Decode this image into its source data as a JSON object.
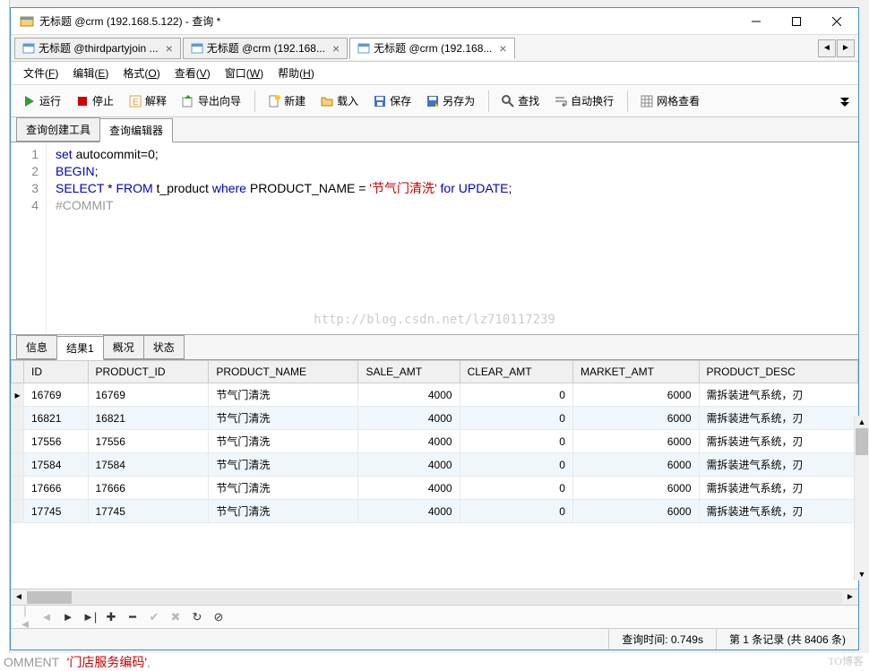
{
  "title": "无标题 @crm (192.168.5.122) - 查询 *",
  "docTabs": [
    {
      "label": "无标题 @thirdpartyjoin ...",
      "active": false
    },
    {
      "label": "无标题 @crm (192.168...",
      "active": false
    },
    {
      "label": "无标题 @crm (192.168...",
      "active": true
    }
  ],
  "menu": {
    "file": "文件",
    "file_key": "F",
    "edit": "编辑",
    "edit_key": "E",
    "format": "格式",
    "format_key": "O",
    "view": "查看",
    "view_key": "V",
    "window": "窗口",
    "window_key": "W",
    "help": "帮助",
    "help_key": "H"
  },
  "toolbar": {
    "run": "运行",
    "stop": "停止",
    "explain": "解释",
    "export": "导出向导",
    "new": "新建",
    "load": "载入",
    "save": "保存",
    "saveas": "另存为",
    "find": "查找",
    "wrap": "自动换行",
    "gridview": "网格查看"
  },
  "subtabs": {
    "builder": "查询创建工具",
    "editor": "查询编辑器"
  },
  "editorLines": [
    "1",
    "2",
    "3",
    "4"
  ],
  "sql": {
    "l1_kw1": "set",
    "l1_rest": " autocommit=0;",
    "l2": "BEGIN",
    "l3_kw1": "SELECT",
    "l3_kw2": "FROM",
    "l3_tbl": " t_product ",
    "l3_kw3": "where",
    "l3_col": " PRODUCT_NAME = ",
    "l3_str": "'节气门清洗'",
    "l3_kw4": " for ",
    "l3_kw5": "UPDATE",
    "l4": "#COMMIT"
  },
  "watermark": "http://blog.csdn.net/lz710117239",
  "resultTabs": {
    "info": "信息",
    "result": "结果1",
    "profile": "概况",
    "status": "状态"
  },
  "columns": [
    "ID",
    "PRODUCT_ID",
    "PRODUCT_NAME",
    "SALE_AMT",
    "CLEAR_AMT",
    "MARKET_AMT",
    "PRODUCT_DESC"
  ],
  "rows": [
    {
      "id": "16769",
      "pid": "16769",
      "name": "节气门清洗",
      "sale": "4000",
      "clear": "0",
      "market": "6000",
      "desc": "需拆装进气系统，刃"
    },
    {
      "id": "16821",
      "pid": "16821",
      "name": "节气门清洗",
      "sale": "4000",
      "clear": "0",
      "market": "6000",
      "desc": "需拆装进气系统，刃"
    },
    {
      "id": "17556",
      "pid": "17556",
      "name": "节气门清洗",
      "sale": "4000",
      "clear": "0",
      "market": "6000",
      "desc": "需拆装进气系统，刃"
    },
    {
      "id": "17584",
      "pid": "17584",
      "name": "节气门清洗",
      "sale": "4000",
      "clear": "0",
      "market": "6000",
      "desc": "需拆装进气系统，刃"
    },
    {
      "id": "17666",
      "pid": "17666",
      "name": "节气门清洗",
      "sale": "4000",
      "clear": "0",
      "market": "6000",
      "desc": "需拆装进气系统，刃"
    },
    {
      "id": "17745",
      "pid": "17745",
      "name": "节气门清洗",
      "sale": "4000",
      "clear": "0",
      "market": "6000",
      "desc": "需拆装进气系统，刃"
    }
  ],
  "status": {
    "queryTime": "查询时间: 0.749s",
    "record": "第 1 条记录 (共 8406 条)"
  },
  "bottomFragKw": "OMMENT",
  "bottomFragStr": "'门店服务编码'",
  "bottomFragEnd": ",",
  "footerBrand": "TO博客"
}
